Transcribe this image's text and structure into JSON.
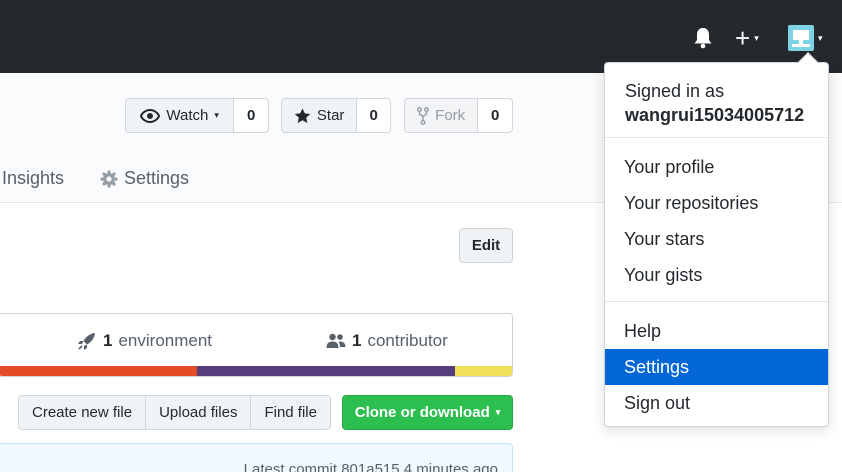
{
  "header": {
    "bell_icon": "bell-icon",
    "plus_icon": "+",
    "caret_icon": "▾",
    "avatar_color": "#7fd3e6"
  },
  "repo_actions": {
    "watch": {
      "label": "Watch",
      "count": "0"
    },
    "star": {
      "label": "Star",
      "count": "0"
    },
    "fork": {
      "label": "Fork",
      "count": "0"
    }
  },
  "tabs": {
    "insights": "Insights",
    "settings": "Settings"
  },
  "edit_label": "Edit",
  "summary": {
    "environment_count": "1",
    "environment_label": "environment",
    "contributor_count": "1",
    "contributor_label": "contributor",
    "languages": [
      {
        "color": "#e34c26",
        "percent": 38.5
      },
      {
        "color": "#563d7c",
        "percent": 50.3
      },
      {
        "color": "#f1e05a",
        "percent": 11.2
      }
    ]
  },
  "file_actions": {
    "create": "Create new file",
    "upload": "Upload files",
    "find": "Find file",
    "clone": "Clone or download"
  },
  "commit": {
    "text": "Latest commit 801a515 4 minutes ago"
  },
  "dropdown": {
    "signed_in_as": "Signed in as",
    "username": "wangrui15034005712",
    "items": [
      {
        "label": "Your profile"
      },
      {
        "label": "Your repositories"
      },
      {
        "label": "Your stars"
      },
      {
        "label": "Your gists"
      },
      {
        "label": "Help"
      },
      {
        "label": "Settings",
        "active": true
      },
      {
        "label": "Sign out"
      }
    ]
  },
  "colors": {
    "header_bg": "#24292e",
    "accent": "#0366d6",
    "green": "#2cbe4e"
  }
}
